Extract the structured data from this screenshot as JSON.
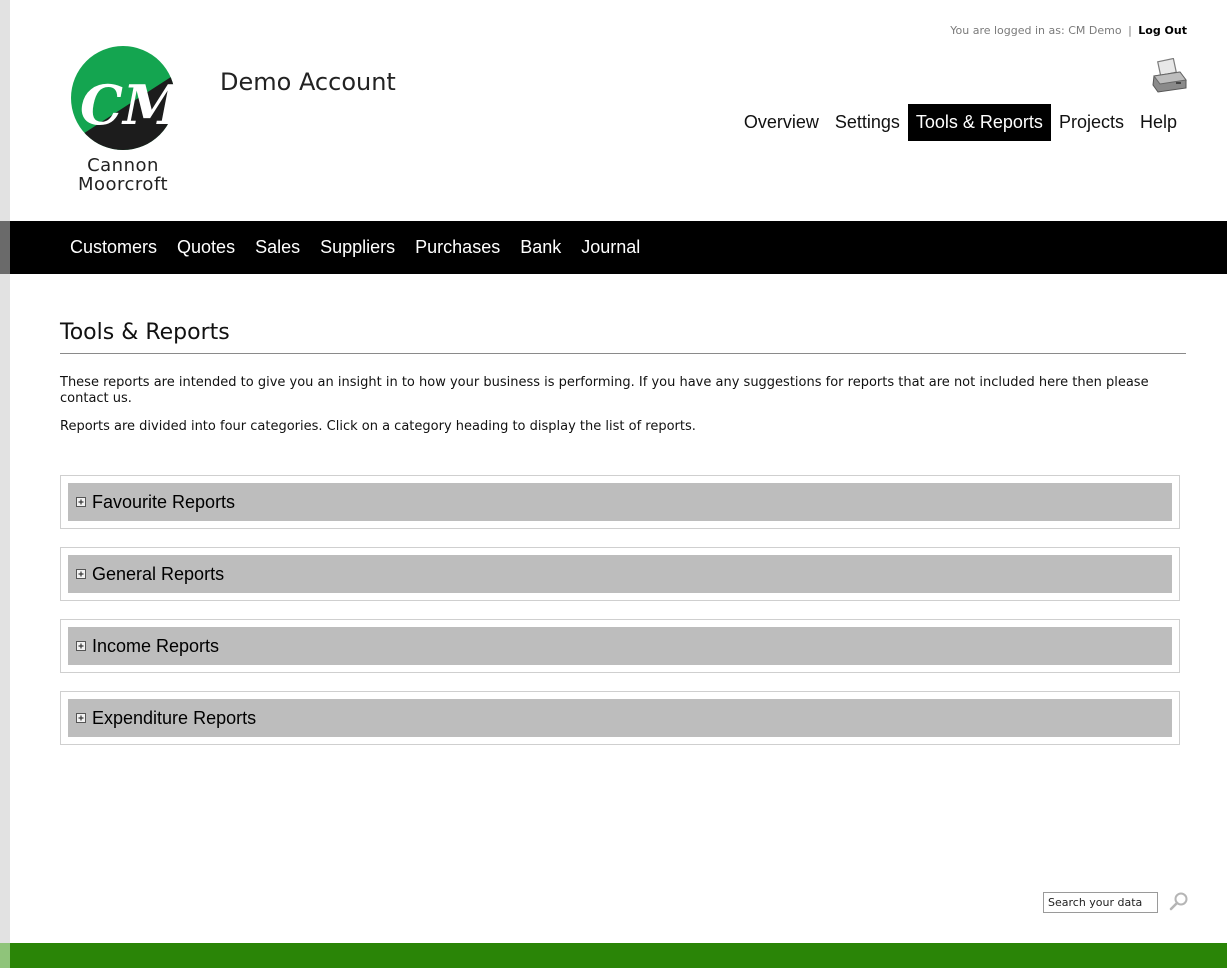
{
  "header": {
    "login_prefix": "You are logged in as:",
    "user_name": "CM Demo",
    "separator": "|",
    "logout_label": "Log Out",
    "account_title": "Demo Account",
    "logo": {
      "line1": "Cannon",
      "line2": "Moorcroft",
      "icon": "cm-logo-icon"
    },
    "printer_icon": "printer-icon"
  },
  "top_nav": {
    "items": [
      {
        "label": "Overview"
      },
      {
        "label": "Settings"
      },
      {
        "label": "Tools & Reports"
      },
      {
        "label": "Projects"
      },
      {
        "label": "Help"
      }
    ],
    "active": "Tools & Reports"
  },
  "sub_nav": {
    "items": [
      {
        "label": "Customers"
      },
      {
        "label": "Quotes"
      },
      {
        "label": "Sales"
      },
      {
        "label": "Suppliers"
      },
      {
        "label": "Purchases"
      },
      {
        "label": "Bank"
      },
      {
        "label": "Journal"
      }
    ]
  },
  "main": {
    "title": "Tools & Reports",
    "intro_1": "These reports are intended to give you an insight in to how your business is performing. If you have any suggestions for reports that are not included here then please contact us.",
    "intro_2": "Reports are divided into four categories. Click on a category heading to display the list of reports.",
    "report_groups": [
      {
        "label": "Favourite Reports"
      },
      {
        "label": "General Reports"
      },
      {
        "label": "Income Reports"
      },
      {
        "label": "Expenditure Reports"
      }
    ]
  },
  "search": {
    "placeholder": "Search your data",
    "icon": "search-icon"
  },
  "colors": {
    "green_brand": "#2a8507",
    "logo_green": "#14a550",
    "nav_black": "#000000",
    "report_header_grey": "#bdbdbd"
  }
}
